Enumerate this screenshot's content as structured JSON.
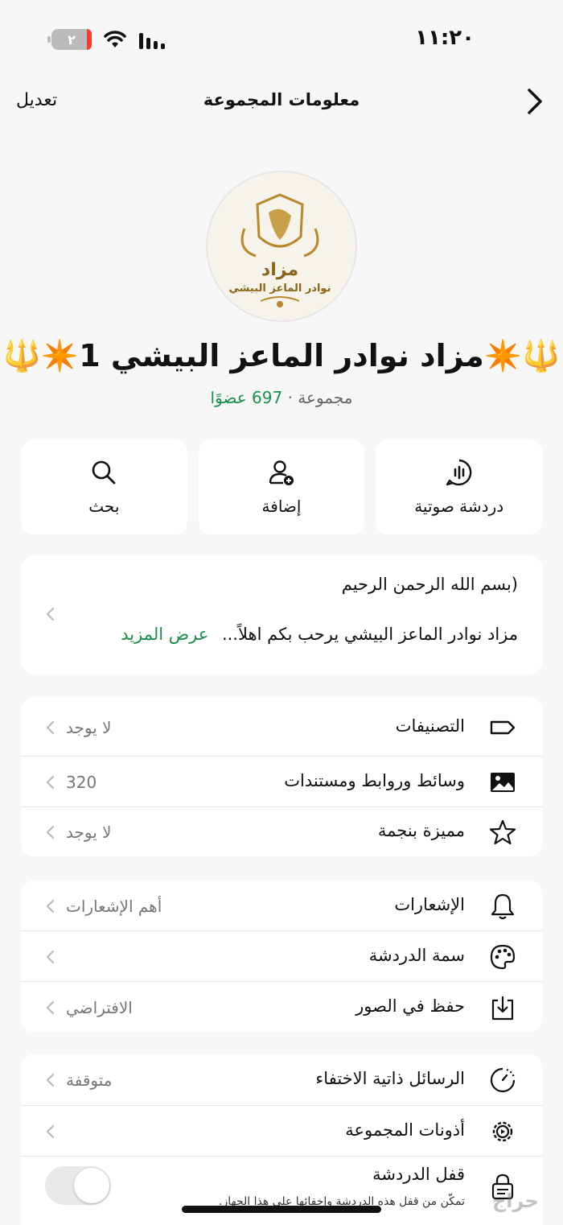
{
  "status_bar": {
    "time": "١١:٢٠",
    "battery": "٢"
  },
  "nav": {
    "title": "معلومات المجموعة",
    "edit": "تعديل"
  },
  "avatar": {
    "logo_text_1": "مزاد",
    "logo_text_2": "نوادر الماعز البيشي"
  },
  "group": {
    "name": "🔱✴️مزاد نوادر الماعز البيشي 1✴️🔱",
    "type": "مجموعة · ",
    "members": "697 عضوًا"
  },
  "actions": [
    {
      "label": "دردشة صوتية",
      "icon": "voice-chat-icon"
    },
    {
      "label": "إضافة",
      "icon": "add-person-icon"
    },
    {
      "label": "بحث",
      "icon": "search-icon"
    }
  ],
  "description": {
    "line1": "(بسم الله الرحمن الرحيم",
    "line2": "مزاد نوادر الماعز البيشي يرحب بكم اهلاً...",
    "more": "عرض المزيد"
  },
  "section1": [
    {
      "label": "التصنيفات",
      "value": "لا يوجد",
      "icon": "tag-icon"
    },
    {
      "label": "وسائط وروابط ومستندات",
      "value": "320",
      "icon": "media-icon"
    },
    {
      "label": "مميزة بنجمة",
      "value": "لا يوجد",
      "icon": "star-icon"
    }
  ],
  "section2": [
    {
      "label": "الإشعارات",
      "value": "أهم الإشعارات",
      "icon": "bell-icon"
    },
    {
      "label": "سمة الدردشة",
      "value": "",
      "icon": "palette-icon"
    },
    {
      "label": "حفظ في الصور",
      "value": "الافتراضي",
      "icon": "save-photos-icon"
    }
  ],
  "section3": [
    {
      "label": "الرسائل ذاتية الاختفاء",
      "value": "متوقفة",
      "icon": "timer-icon"
    },
    {
      "label": "أذونات المجموعة",
      "value": "",
      "icon": "settings-gear-icon"
    },
    {
      "label": "قفل الدردشة",
      "sub": "تمكّن من قفل هذه الدردشة وإخفائها على هذا الجهاز.",
      "icon": "chat-lock-icon",
      "toggle": false
    }
  ],
  "watermark": "حراج",
  "colors": {
    "accent": "#1b8f4d",
    "background": "#f7f7f7",
    "card": "#ffffff"
  }
}
